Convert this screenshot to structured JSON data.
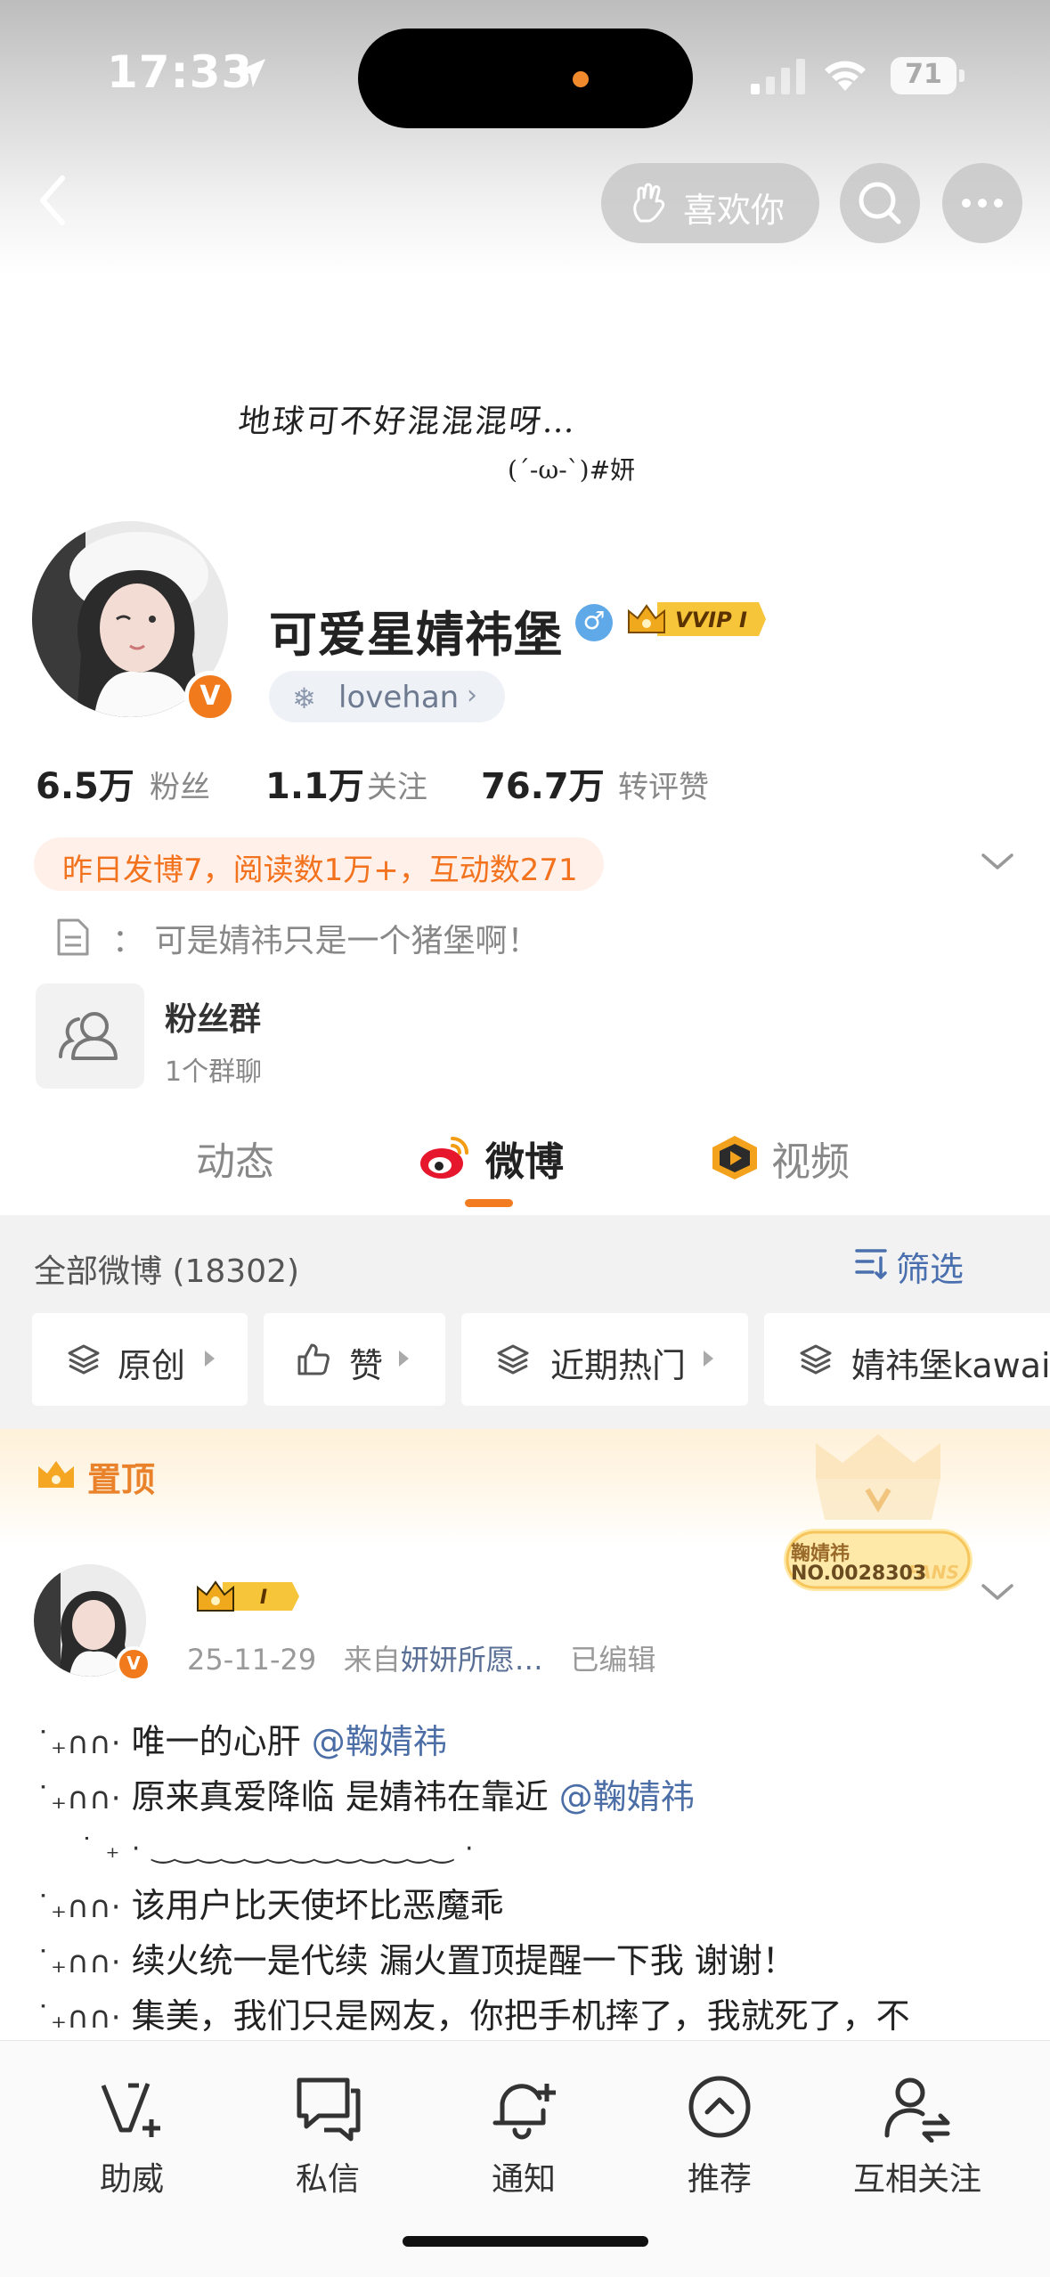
{
  "status_bar": {
    "time": "17:33",
    "battery": "71"
  },
  "header": {
    "like_label": "喜欢你"
  },
  "banner": {
    "line1": "地球可不好混混混呀…",
    "line2": "(ˊ-ω-ˋ)#妍"
  },
  "profile": {
    "name": "可爱星婧祎堡",
    "gender_symbol": "♂",
    "vip_label": "VVIP I",
    "verified_mark": "V",
    "tag_text": "lovehan",
    "stats": [
      {
        "num": "6.5万",
        "label": "粉丝"
      },
      {
        "num": "1.1万",
        "label": "关注"
      },
      {
        "num": "76.7万",
        "label": "转评赞"
      }
    ],
    "activity": "昨日发博7，阅读数1万+，互动数271",
    "bio": "：  可是婧祎只是一个猪堡啊！",
    "fan_group": {
      "title": "粉丝群",
      "sub": "1个群聊"
    }
  },
  "tabs": [
    {
      "label": "动态"
    },
    {
      "label": "微博"
    },
    {
      "label": "视频"
    }
  ],
  "filters": {
    "all_label": "全部微博 (18302)",
    "filter_label": "筛选",
    "chips": [
      {
        "label": "原创"
      },
      {
        "label": "赞"
      },
      {
        "label": "近期热门"
      },
      {
        "label": "婧祎堡kawai"
      }
    ]
  },
  "pinned": {
    "label": "置顶",
    "fans_name": "鞠婧祎",
    "fans_no": "NO.0028303",
    "fans_word": "FANS",
    "member_level": "I"
  },
  "post": {
    "date": "25-11-29",
    "from_prefix": "来自",
    "source": "妍妍所愿…",
    "edited": "已编辑",
    "deco": "˙₊∩∩·",
    "lines": [
      {
        "text": "唯一的心肝 ",
        "mention": "@鞠婧祎"
      },
      {
        "text": "原来真爱降临 是婧祎在靠近 ",
        "mention": "@鞠婧祎"
      },
      {
        "text": "该用户比天使坏比恶魔乖",
        "mention": ""
      },
      {
        "text": "续火统一是代续 漏火置顶提醒一下我 谢谢！",
        "mention": ""
      },
      {
        "text": "集美，我们只是网友，你把手机摔了，我就死了，不",
        "mention": ""
      }
    ],
    "wave": "˙  ₊  ·   ‿‿‿‿‿‿‿‿‿‿‿‿‿    ·"
  },
  "bottom_bar": [
    {
      "label": "助威",
      "icon": "v-plus-icon"
    },
    {
      "label": "私信",
      "icon": "chat-icon"
    },
    {
      "label": "通知",
      "icon": "bell-icon"
    },
    {
      "label": "推荐",
      "icon": "chevron-up-circle-icon"
    },
    {
      "label": "互相关注",
      "icon": "mutual-follow-icon"
    }
  ],
  "colors": {
    "accent_orange": "#f37c20",
    "link_blue": "#4c6ea6",
    "gray_text": "#888888"
  }
}
